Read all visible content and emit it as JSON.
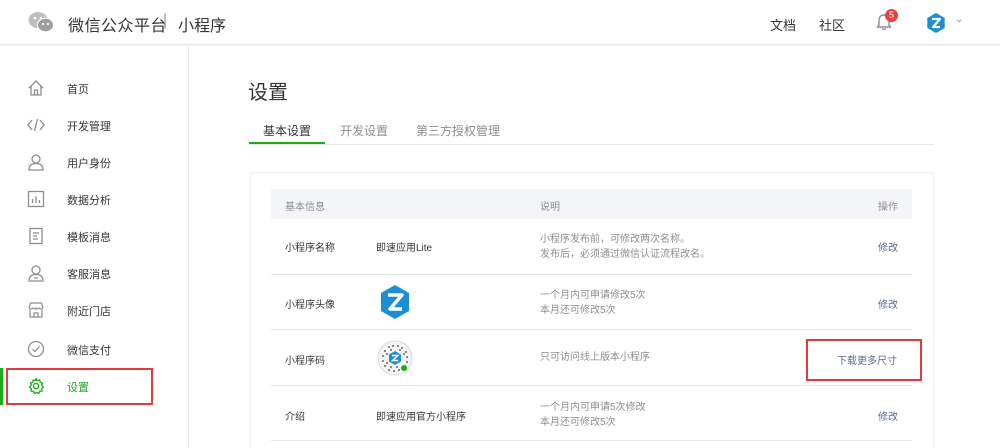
{
  "header": {
    "title": "微信公众平台",
    "separator": "|",
    "subtitle": "小程序",
    "nav_docs": "文档",
    "nav_community": "社区",
    "notification_count": "5"
  },
  "sidebar": {
    "items": [
      {
        "label": "首页",
        "icon": "home-icon"
      },
      {
        "label": "开发管理",
        "icon": "code-icon"
      },
      {
        "label": "用户身份",
        "icon": "user-icon"
      },
      {
        "label": "数据分析",
        "icon": "chart-icon"
      },
      {
        "label": "模板消息",
        "icon": "template-icon"
      },
      {
        "label": "客服消息",
        "icon": "customer-service-icon"
      },
      {
        "label": "附近门店",
        "icon": "store-icon"
      },
      {
        "label": "微信支付",
        "icon": "payment-icon"
      },
      {
        "label": "设置",
        "icon": "gear-icon"
      }
    ],
    "active_color": "#1aad19"
  },
  "main": {
    "title": "设置",
    "tabs": [
      {
        "label": "基本设置"
      },
      {
        "label": "开发设置"
      },
      {
        "label": "第三方授权管理"
      }
    ],
    "table": {
      "headers": {
        "info": "基本信息",
        "desc": "说明",
        "action": "操作"
      },
      "rows": [
        {
          "label": "小程序名称",
          "value": "即速应用Lite",
          "desc": [
            "小程序发布前，可修改两次名称。",
            "发布后，必须通过微信认证流程改名。"
          ],
          "action": "修改"
        },
        {
          "label": "小程序头像",
          "value": "",
          "desc": [
            "一个月内可申请修改5次",
            "本月还可修改5次"
          ],
          "action": "修改"
        },
        {
          "label": "小程序码",
          "value": "",
          "desc": [
            "只可访问线上版本小程序"
          ],
          "action": "下载更多尺寸"
        },
        {
          "label": "介绍",
          "value": "即速应用官方小程序",
          "desc": [
            "一个月内可申请5次修改",
            "本月还可修改5次"
          ],
          "action": "修改"
        }
      ]
    }
  },
  "colors": {
    "accent_green": "#1aad19",
    "link_blue": "#576b95",
    "highlight_red": "#e13b3b",
    "badge_red": "#e64340"
  }
}
